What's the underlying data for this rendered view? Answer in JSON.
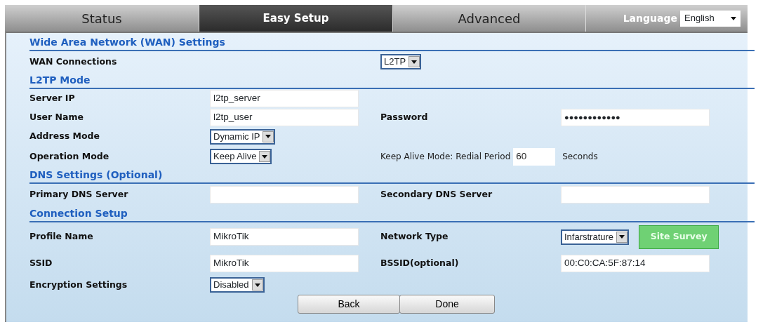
{
  "tabs": [
    {
      "label": "Status",
      "selected": false
    },
    {
      "label": "Easy Setup",
      "selected": true
    },
    {
      "label": "Advanced",
      "selected": false
    }
  ],
  "language": {
    "label": "Language",
    "value": "English"
  },
  "sections": [
    {
      "heading": "Wide Area Network (WAN) Settings",
      "rows": [
        {
          "kind": "split",
          "cells": [
            {
              "kind": "label",
              "text": "WAN Connections"
            },
            {
              "kind": "select",
              "value": "L2TP"
            }
          ]
        }
      ]
    },
    {
      "heading": "L2TP Mode",
      "rows": [
        {
          "kind": "pair",
          "cells": [
            {
              "kind": "label",
              "text": "Server IP"
            },
            {
              "kind": "input",
              "value": "l2tp_server"
            }
          ]
        },
        {
          "kind": "pair",
          "cells": [
            {
              "kind": "label",
              "text": "User Name"
            },
            {
              "kind": "input",
              "value": "l2tp_user"
            },
            {
              "kind": "label",
              "text": "Password"
            },
            {
              "kind": "password",
              "value": "●●●●●●●●●●●●"
            }
          ]
        },
        {
          "kind": "pair",
          "cells": [
            {
              "kind": "label",
              "text": "Address Mode"
            },
            {
              "kind": "select",
              "value": "Dynamic IP"
            }
          ]
        },
        {
          "kind": "pair",
          "cells": [
            {
              "kind": "label",
              "text": "Operation Mode"
            },
            {
              "kind": "select",
              "value": "Keep Alive"
            },
            {
              "kind": "period",
              "text": "Keep Alive Mode: Redial Period",
              "value": "60",
              "unit": "Seconds"
            }
          ]
        }
      ]
    },
    {
      "heading": "DNS Settings (Optional)",
      "rows": [
        {
          "kind": "pair",
          "cells": [
            {
              "kind": "label",
              "text": "Primary DNS Server"
            },
            {
              "kind": "input"
            },
            {
              "kind": "label",
              "text": "Secondary DNS Server"
            },
            {
              "kind": "input"
            }
          ]
        }
      ]
    },
    {
      "heading": "Connection Setup",
      "rows": [
        {
          "kind": "pair",
          "cells": [
            {
              "kind": "label",
              "text": "Profile Name"
            },
            {
              "kind": "input",
              "value": "MikroTik"
            },
            {
              "kind": "label",
              "text": "Network Type"
            },
            {
              "kind": "select",
              "value": "Infarstrature",
              "button": "Site Survey"
            }
          ]
        },
        {
          "kind": "pair",
          "cells": [
            {
              "kind": "label",
              "text": "SSID"
            },
            {
              "kind": "input",
              "value": "MikroTik"
            },
            {
              "kind": "label",
              "text": "BSSID(optional)"
            },
            {
              "kind": "input",
              "value": "00:C0:CA:5F:87:14"
            }
          ]
        },
        {
          "kind": "pair",
          "cells": [
            {
              "kind": "label",
              "text": "Encryption Settings"
            },
            {
              "kind": "select",
              "value": "Disabled"
            }
          ]
        }
      ]
    }
  ],
  "buttons": [
    "Back",
    "Done"
  ]
}
